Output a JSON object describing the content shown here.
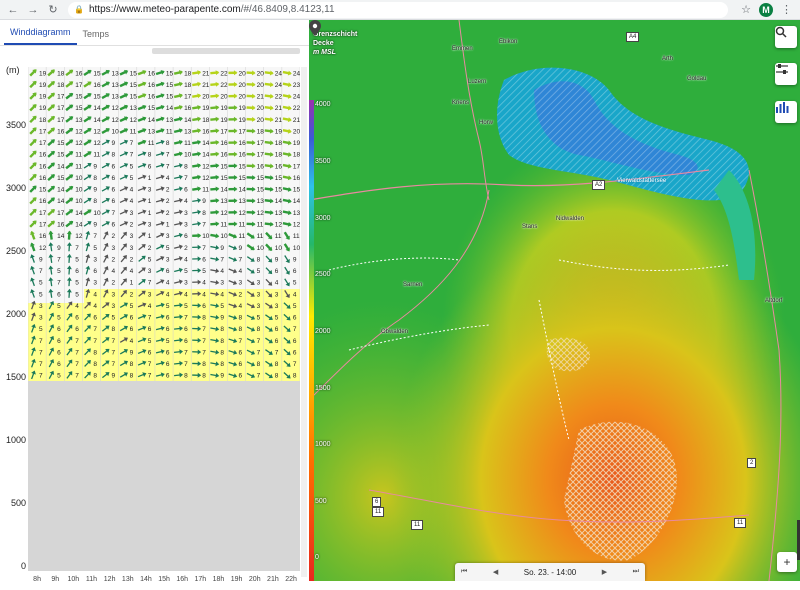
{
  "browser": {
    "url_host": "https://www.meteo-parapente.com",
    "url_path": "/#/46.8409,8.4123,11",
    "back_icon": "back-arrow-icon",
    "forward_icon": "forward-arrow-icon",
    "reload_icon": "reload-icon",
    "profile_initial": "M"
  },
  "tabs": [
    {
      "label": "Winddiagramm",
      "active": true
    },
    {
      "label": "Temps",
      "active": false
    }
  ],
  "diagram": {
    "unit_label": "(m)",
    "y_ticks": [
      "3500",
      "3000",
      "2500",
      "2000",
      "1500",
      "1000",
      "500",
      "0"
    ],
    "terrain_color": "#d6d6d6",
    "thermal_color": "#ffff8a",
    "speed_rows": [
      [
        "19",
        "18",
        "16",
        "15",
        "13",
        "15",
        "16",
        "15",
        "18",
        "21",
        "22",
        "20",
        "20",
        "24",
        "24"
      ],
      [
        "19",
        "18",
        "17",
        "16",
        "13",
        "15",
        "16",
        "15",
        "18",
        "21",
        "22",
        "20",
        "20",
        "24",
        "23"
      ],
      [
        "19",
        "17",
        "15",
        "15",
        "13",
        "15",
        "16",
        "15",
        "17",
        "20",
        "20",
        "20",
        "21",
        "22",
        "24"
      ],
      [
        "19",
        "17",
        "15",
        "14",
        "12",
        "13",
        "15",
        "14",
        "16",
        "19",
        "19",
        "19",
        "20",
        "21",
        "22"
      ],
      [
        "18",
        "17",
        "13",
        "14",
        "12",
        "12",
        "14",
        "13",
        "14",
        "18",
        "19",
        "19",
        "20",
        "21",
        "21"
      ],
      [
        "17",
        "16",
        "12",
        "12",
        "10",
        "11",
        "13",
        "11",
        "13",
        "16",
        "17",
        "17",
        "18",
        "19",
        "20"
      ],
      [
        "17",
        "15",
        "12",
        "12",
        "9",
        "7",
        "11",
        "8",
        "11",
        "14",
        "16",
        "16",
        "17",
        "18",
        "19"
      ],
      [
        "16",
        "15",
        "11",
        "11",
        "8",
        "7",
        "8",
        "7",
        "10",
        "14",
        "16",
        "16",
        "17",
        "18",
        "18"
      ],
      [
        "16",
        "14",
        "11",
        "9",
        "6",
        "5",
        "6",
        "7",
        "8",
        "12",
        "15",
        "15",
        "16",
        "16",
        "17"
      ],
      [
        "16",
        "15",
        "10",
        "8",
        "6",
        "5",
        "1",
        "4",
        "7",
        "12",
        "15",
        "15",
        "15",
        "15",
        "16"
      ],
      [
        "15",
        "14",
        "10",
        "9",
        "6",
        "4",
        "3",
        "2",
        "6",
        "11",
        "14",
        "14",
        "15",
        "15",
        "15"
      ],
      [
        "16",
        "14",
        "10",
        "8",
        "6",
        "4",
        "1",
        "2",
        "4",
        "9",
        "13",
        "13",
        "13",
        "14",
        "14"
      ],
      [
        "17",
        "17",
        "14",
        "10",
        "7",
        "3",
        "1",
        "2",
        "3",
        "8",
        "12",
        "12",
        "12",
        "13",
        "13"
      ],
      [
        "17",
        "16",
        "14",
        "9",
        "6",
        "2",
        "3",
        "1",
        "3",
        "7",
        "11",
        "11",
        "11",
        "12",
        "12"
      ],
      [
        "16",
        "14",
        "12",
        "7",
        "2",
        "3",
        "1",
        "3",
        "6",
        "10",
        "10",
        "11",
        "11",
        "11",
        "11"
      ],
      [
        "12",
        "9",
        "7",
        "5",
        "3",
        "3",
        "2",
        "5",
        "2",
        "7",
        "9",
        "9",
        "10",
        "10",
        "10"
      ],
      [
        "9",
        "7",
        "5",
        "3",
        "2",
        "2",
        "5",
        "3",
        "4",
        "6",
        "7",
        "7",
        "8",
        "9",
        "9"
      ],
      [
        "7",
        "5",
        "6",
        "6",
        "4",
        "4",
        "3",
        "6",
        "5",
        "5",
        "4",
        "4",
        "5",
        "6",
        "6"
      ],
      [
        "5",
        "7",
        "5",
        "3",
        "2",
        "1",
        "7",
        "4",
        "3",
        "4",
        "3",
        "3",
        "3",
        "4",
        "5"
      ],
      [
        "5",
        "6",
        "5",
        "4",
        "3",
        "2",
        "3",
        "4",
        "4",
        "4",
        "4",
        "2",
        "3",
        "3",
        "4"
      ],
      [
        "3",
        "5",
        "4",
        "4",
        "3",
        "5",
        "4",
        "5",
        "5",
        "6",
        "5",
        "4",
        "3",
        "3",
        "5"
      ],
      [
        "3",
        "5",
        "6",
        "6",
        "5",
        "6",
        "7",
        "6",
        "7",
        "8",
        "9",
        "8",
        "5",
        "5",
        "6"
      ],
      [
        "5",
        "6",
        "6",
        "7",
        "8",
        "6",
        "6",
        "6",
        "6",
        "7",
        "8",
        "8",
        "8",
        "6",
        "7"
      ],
      [
        "7",
        "6",
        "7",
        "7",
        "7",
        "4",
        "5",
        "5",
        "6",
        "7",
        "8",
        "7",
        "7",
        "6",
        "6"
      ],
      [
        "7",
        "6",
        "7",
        "8",
        "7",
        "9",
        "6",
        "6",
        "7",
        "7",
        "8",
        "6",
        "7",
        "7",
        "6"
      ],
      [
        "7",
        "6",
        "7",
        "8",
        "7",
        "8",
        "7",
        "6",
        "7",
        "8",
        "8",
        "6",
        "8",
        "8",
        "7"
      ],
      [
        "7",
        "5",
        "7",
        "8",
        "9",
        "8",
        "7",
        "6",
        "8",
        "8",
        "9",
        "6",
        "7",
        "8",
        "8"
      ]
    ],
    "time_labels": [
      "8h",
      "9h",
      "10h",
      "11h",
      "12h",
      "13h",
      "14h",
      "15h",
      "16h",
      "17h",
      "18h",
      "19h",
      "20h",
      "21h",
      "22h"
    ]
  },
  "map": {
    "legend_title": [
      "Grenzschicht",
      "Decke",
      "m MSL"
    ],
    "legend_ticks": [
      "4000",
      "3500",
      "3000",
      "2500",
      "2000",
      "1500",
      "1000",
      "500",
      "0"
    ],
    "labels": [
      {
        "text": "Emmen",
        "x": 143,
        "y": 26
      },
      {
        "text": "Ebikon",
        "x": 190,
        "y": 19
      },
      {
        "text": "Luzern",
        "x": 159,
        "y": 59
      },
      {
        "text": "Kriens",
        "x": 143,
        "y": 80
      },
      {
        "text": "Horw",
        "x": 170,
        "y": 100
      },
      {
        "text": "Stans",
        "x": 213,
        "y": 204
      },
      {
        "text": "Nidwalden",
        "x": 247,
        "y": 196
      },
      {
        "text": "Vierwaldstättersee",
        "x": 308,
        "y": 158
      },
      {
        "text": "Arth",
        "x": 353,
        "y": 36
      },
      {
        "text": "Goldau",
        "x": 378,
        "y": 56
      },
      {
        "text": "Sarnen",
        "x": 94,
        "y": 262
      },
      {
        "text": "Obwalden",
        "x": 72,
        "y": 309
      },
      {
        "text": "Altdorf",
        "x": 456,
        "y": 278
      }
    ],
    "road_badges": [
      {
        "text": "A4",
        "x": 317,
        "y": 12
      },
      {
        "text": "A2",
        "x": 283,
        "y": 160
      },
      {
        "text": "2",
        "x": 438,
        "y": 438
      },
      {
        "text": "6",
        "x": 63,
        "y": 477
      },
      {
        "text": "11",
        "x": 63,
        "y": 487
      },
      {
        "text": "11",
        "x": 102,
        "y": 500
      },
      {
        "text": "11",
        "x": 425,
        "y": 498
      }
    ],
    "time_bar": {
      "first_icon": "skip-first-icon",
      "prev_icon": "previous-icon",
      "label": "So. 23. - 14:00",
      "next_icon": "next-icon",
      "last_icon": "skip-last-icon"
    },
    "buttons": [
      "search-icon",
      "settings-sliders-icon",
      "bar-chart-icon"
    ],
    "zoom_in": "+"
  }
}
